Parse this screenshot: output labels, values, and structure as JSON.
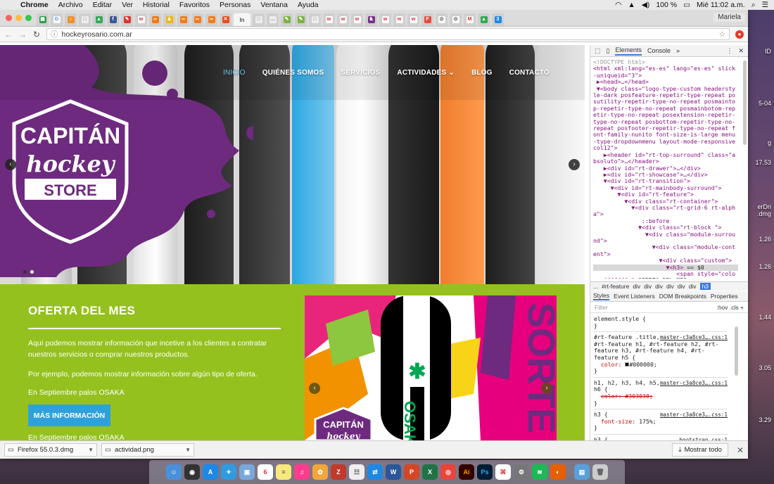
{
  "menubar": {
    "app": "Chrome",
    "items": [
      "Archivo",
      "Editar",
      "Ver",
      "Historial",
      "Favoritos",
      "Personas",
      "Ventana",
      "Ayuda"
    ],
    "battery": "100 %",
    "clock": "Mié 11:02 a.m."
  },
  "browser": {
    "profile": "Mariela",
    "active_tab": "In",
    "url": "hockeyrosario.com.ar"
  },
  "site": {
    "nav": [
      {
        "label": "INICIO",
        "active": true
      },
      {
        "label": "QUIÉNES SOMOS",
        "active": false
      },
      {
        "label": "SERVICIOS",
        "active": false
      },
      {
        "label": "ACTIVIDADES",
        "active": false
      },
      {
        "label": "BLOG",
        "active": false
      },
      {
        "label": "CONTACTO",
        "active": false
      }
    ],
    "logo": {
      "line1": "CAPITÁN",
      "line2": "hockey",
      "line3": "STORE"
    },
    "offer": {
      "title": "OFERTA DEL MES",
      "p1": "Aquí podemos mostrar información que incetive a los clientes a contratar nuestros servicios o comprar nuestros productos.",
      "p2": "Por ejemplo, podemos mostrar información sobre algún tipo de oferta.",
      "p3": "En Septiembre palos OSAKA",
      "button": "MÁS INFORMACIÓN",
      "p4": "En Septiembre palos OSAKA"
    },
    "promo": {
      "word": "SORTE",
      "brand": "OSAKA",
      "logo1": "CAPITÁN",
      "logo2": "hockey"
    }
  },
  "devtools": {
    "tabs": [
      "Elements",
      "Console"
    ],
    "more": "»",
    "breadcrumb": [
      "...",
      "#rt-feature",
      "div",
      "div",
      "div",
      "div",
      "div",
      "div",
      "h3"
    ],
    "style_tabs": [
      "Styles",
      "Event Listeners",
      "DOM Breakpoints",
      "Properties"
    ],
    "filter_placeholder": "Filter",
    "filter_tools": ":hov  .cls  +"
  },
  "downloads": [
    {
      "name": "Firefox 55.0.3.dmg"
    },
    {
      "name": "actividad.png"
    }
  ],
  "show_all": "Mostrar todo",
  "desktop_labels": [
    "ID",
    "5-04",
    "g",
    "17.53",
    "erDri",
    ".dmg",
    "1.26",
    "1.26",
    "1.44",
    "3.05",
    "3.29"
  ]
}
